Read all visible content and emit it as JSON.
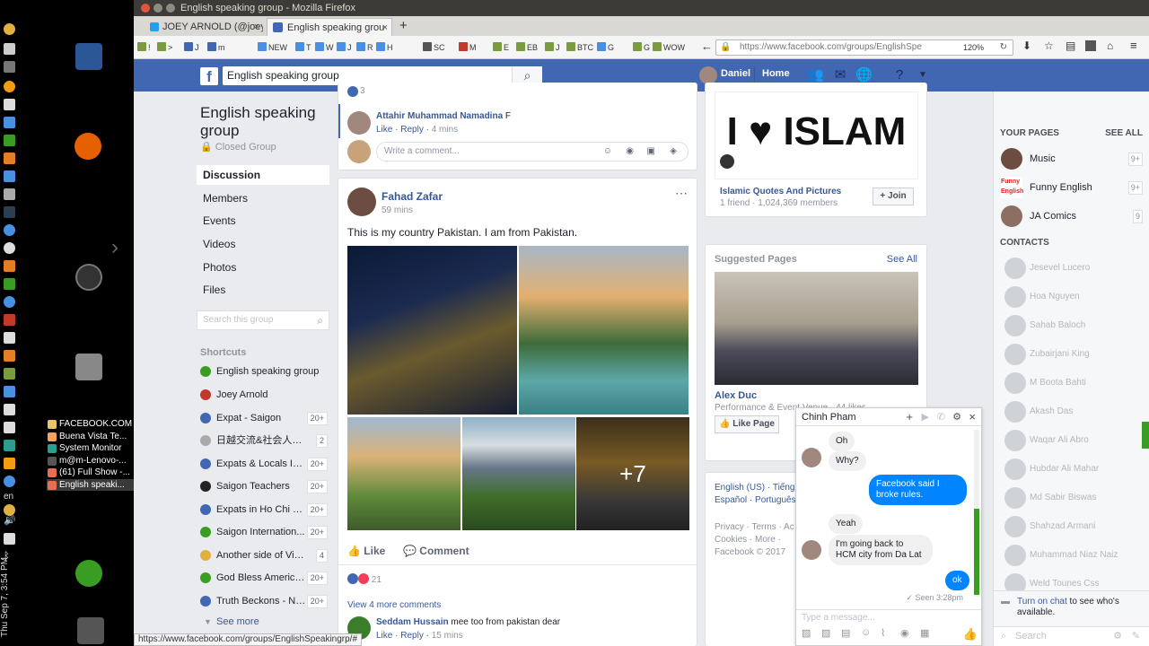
{
  "firefox": {
    "window_title": "English speaking group - Mozilla Firefox",
    "tabs": [
      {
        "label": "JOEY ARNOLD (@joey",
        "close": "×"
      },
      {
        "label": "English speaking grou",
        "close": "×"
      }
    ],
    "new_tab": "+",
    "bookmarks": [
      "!",
      ">",
      "J",
      "m",
      "NEW",
      "T",
      "W",
      "J",
      "R",
      "H",
      "SC",
      "M",
      "E",
      "EB",
      "J",
      "BTC",
      "G",
      "G",
      "WOW"
    ],
    "url": "https://www.facebook.com/groups/EnglishSpe",
    "zoom": "120%",
    "status_url": "https://www.facebook.com/groups/EnglishSpeakingrp/#"
  },
  "os": {
    "clock": "Thu Sep 7, 3:54 PM",
    "lang": "en",
    "windows": [
      {
        "label": "FACEBOOK.COM",
        "color": "#e9c46a"
      },
      {
        "label": "Buena Vista Te...",
        "color": "#f4a261"
      },
      {
        "label": "System Monitor",
        "color": "#2a9d8f"
      },
      {
        "label": "m@m-Lenovo-...",
        "color": "#555555"
      },
      {
        "label": "(61) Full Show -...",
        "color": "#e76f51"
      },
      {
        "label": "English speaki...",
        "color": "#e76f51"
      }
    ]
  },
  "fb": {
    "logo": "f",
    "search_value": "English speaking group",
    "user": "Daniel",
    "home": "Home"
  },
  "group": {
    "title": "English speaking group",
    "type": "Closed Group",
    "nav": [
      "Discussion",
      "Members",
      "Events",
      "Videos",
      "Photos",
      "Files"
    ],
    "search_placeholder": "Search this group",
    "shortcuts_title": "Shortcuts",
    "shortcuts": [
      {
        "label": "English speaking group",
        "badge": "",
        "color": "#3a9d23"
      },
      {
        "label": "Joey Arnold",
        "badge": "",
        "color": "#c0392b"
      },
      {
        "label": "Expat - Saigon",
        "badge": "20+",
        "color": "#4267b2"
      },
      {
        "label": "日越交流&社会人ボ...",
        "badge": "2",
        "color": "#aaaaaa"
      },
      {
        "label": "Expats & Locals In ...",
        "badge": "20+",
        "color": "#4267b2"
      },
      {
        "label": "Saigon Teachers",
        "badge": "20+",
        "color": "#222222"
      },
      {
        "label": "Expats in Ho Chi Mi...",
        "badge": "20+",
        "color": "#4267b2"
      },
      {
        "label": "Saigon Internation...",
        "badge": "20+",
        "color": "#3a9d23"
      },
      {
        "label": "Another side of Vietn...",
        "badge": "4",
        "color": "#e0b040"
      },
      {
        "label": "God Bless America...",
        "badge": "20+",
        "color": "#3a9d23"
      },
      {
        "label": "Truth Beckons - No...",
        "badge": "20+",
        "color": "#4267b2"
      }
    ],
    "see_more": "See more"
  },
  "feed": {
    "prev_comment": {
      "count": "3",
      "author": "Attahir Muhammad Namadina",
      "text": "F",
      "like": "Like",
      "reply": "Reply",
      "time": "4 mins",
      "write_placeholder": "Write a comment..."
    },
    "post": {
      "author": "Fahad Zafar",
      "time": "59 mins",
      "text": "This is my country Pakistan. I am from Pakistan.",
      "more_photos": "+7",
      "like": "Like",
      "comment": "Comment",
      "reactions": "21",
      "view_more": "View 4 more comments",
      "comment_author": "Seddam Hussain",
      "comment_text": "mee too from pakistan dear",
      "comment_like": "Like",
      "comment_reply": "Reply",
      "comment_time": "15 mins"
    }
  },
  "right": {
    "page_name": "Islamic Quotes And Pictures",
    "page_stats": "1 friend · 1,024,369 members",
    "join": "Join",
    "ad_text": "I ♥ ISLAM",
    "suggested_title": "Suggested Pages",
    "see_all": "See All",
    "suggest_name": "Alex Duc",
    "suggest_meta": "Performance & Event Venue · 44 likes",
    "like_page": "Like Page",
    "lang_line1": "English (US) · Tiếng",
    "lang_line2": "Español · Português",
    "footer1": "Privacy · Terms · Ac",
    "footer2": "Cookies · More ·",
    "footer3": "Facebook © 2017"
  },
  "chat_sidebar": {
    "your_pages": "YOUR PAGES",
    "see_all": "SEE ALL",
    "pages": [
      {
        "name": "Music",
        "count": "9+"
      },
      {
        "name": "Funny English",
        "count": "9+"
      },
      {
        "name": "JA Comics",
        "count": "9"
      }
    ],
    "contacts_title": "CONTACTS",
    "contacts": [
      "Jesevel Lucero",
      "Hoa Nguyen",
      "Sahab Baloch",
      "Zubairjani King",
      "M Boota Bahti",
      "Akash Das",
      "Waqar Ali Abro",
      "Hubdar Ali Mahar",
      "Md Sabir Biswas",
      "Shahzad Armani",
      "Muhammad Niaz Naiz",
      "Weld Tounes Css"
    ],
    "turn_on": "Turn on chat",
    "turn_on_rest": " to see who's available.",
    "search": "Search"
  },
  "chat": {
    "name": "Chinh Pham",
    "messages": [
      {
        "side": "in",
        "text": "Oh"
      },
      {
        "side": "in",
        "text": "Why?"
      },
      {
        "side": "out",
        "text": "Facebook said I broke rules."
      },
      {
        "side": "in",
        "text": "Yeah"
      },
      {
        "side": "in",
        "text": "I'm going back to HCM city from Da Lat"
      },
      {
        "side": "out",
        "text": "ok"
      }
    ],
    "seen": "✓ Seen 3:28pm",
    "input_placeholder": "Type a message..."
  }
}
